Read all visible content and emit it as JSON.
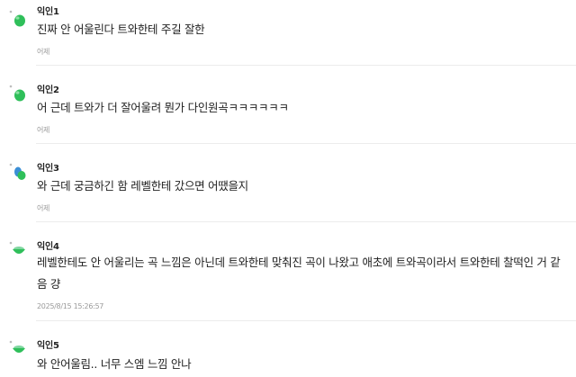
{
  "comments": [
    {
      "nickname": "익인1",
      "text": "진짜 안 어울린다 트와한테 주길 잘한",
      "date": "어제",
      "avatar_icon": "green-blob-icon"
    },
    {
      "nickname": "익인2",
      "text": "어 근데 트와가 더 잘어울려 뭔가 다인원곡ㅋㅋㅋㅋㅋㅋ",
      "date": "어제",
      "avatar_icon": "green-blob-icon"
    },
    {
      "nickname": "익인3",
      "text": "와 근데 궁금하긴 함 레벨한테 갔으면 어땠을지",
      "date": "어제",
      "avatar_icon": "blue-green-blob-icon"
    },
    {
      "nickname": "익인4",
      "text": "레벨한테도 안 어울리는 곡 느낌은 아닌데 트와한테 맞춰진 곡이 나왔고 애초에 트와곡이라서 트와한테 찰떡인 거 같음 걍",
      "date": "2025/8/15 15:26:57",
      "avatar_icon": "green-dish-icon"
    },
    {
      "nickname": "익인5",
      "text": "와 안어울림.. 너무 스엠 느낌 안나",
      "date": "",
      "avatar_icon": "green-dish-icon"
    }
  ],
  "colors": {
    "avatar_green": "#2fbf5a",
    "avatar_blue": "#3b8fd6",
    "divider": "#ececec",
    "date_gray": "#9a9a9a"
  }
}
